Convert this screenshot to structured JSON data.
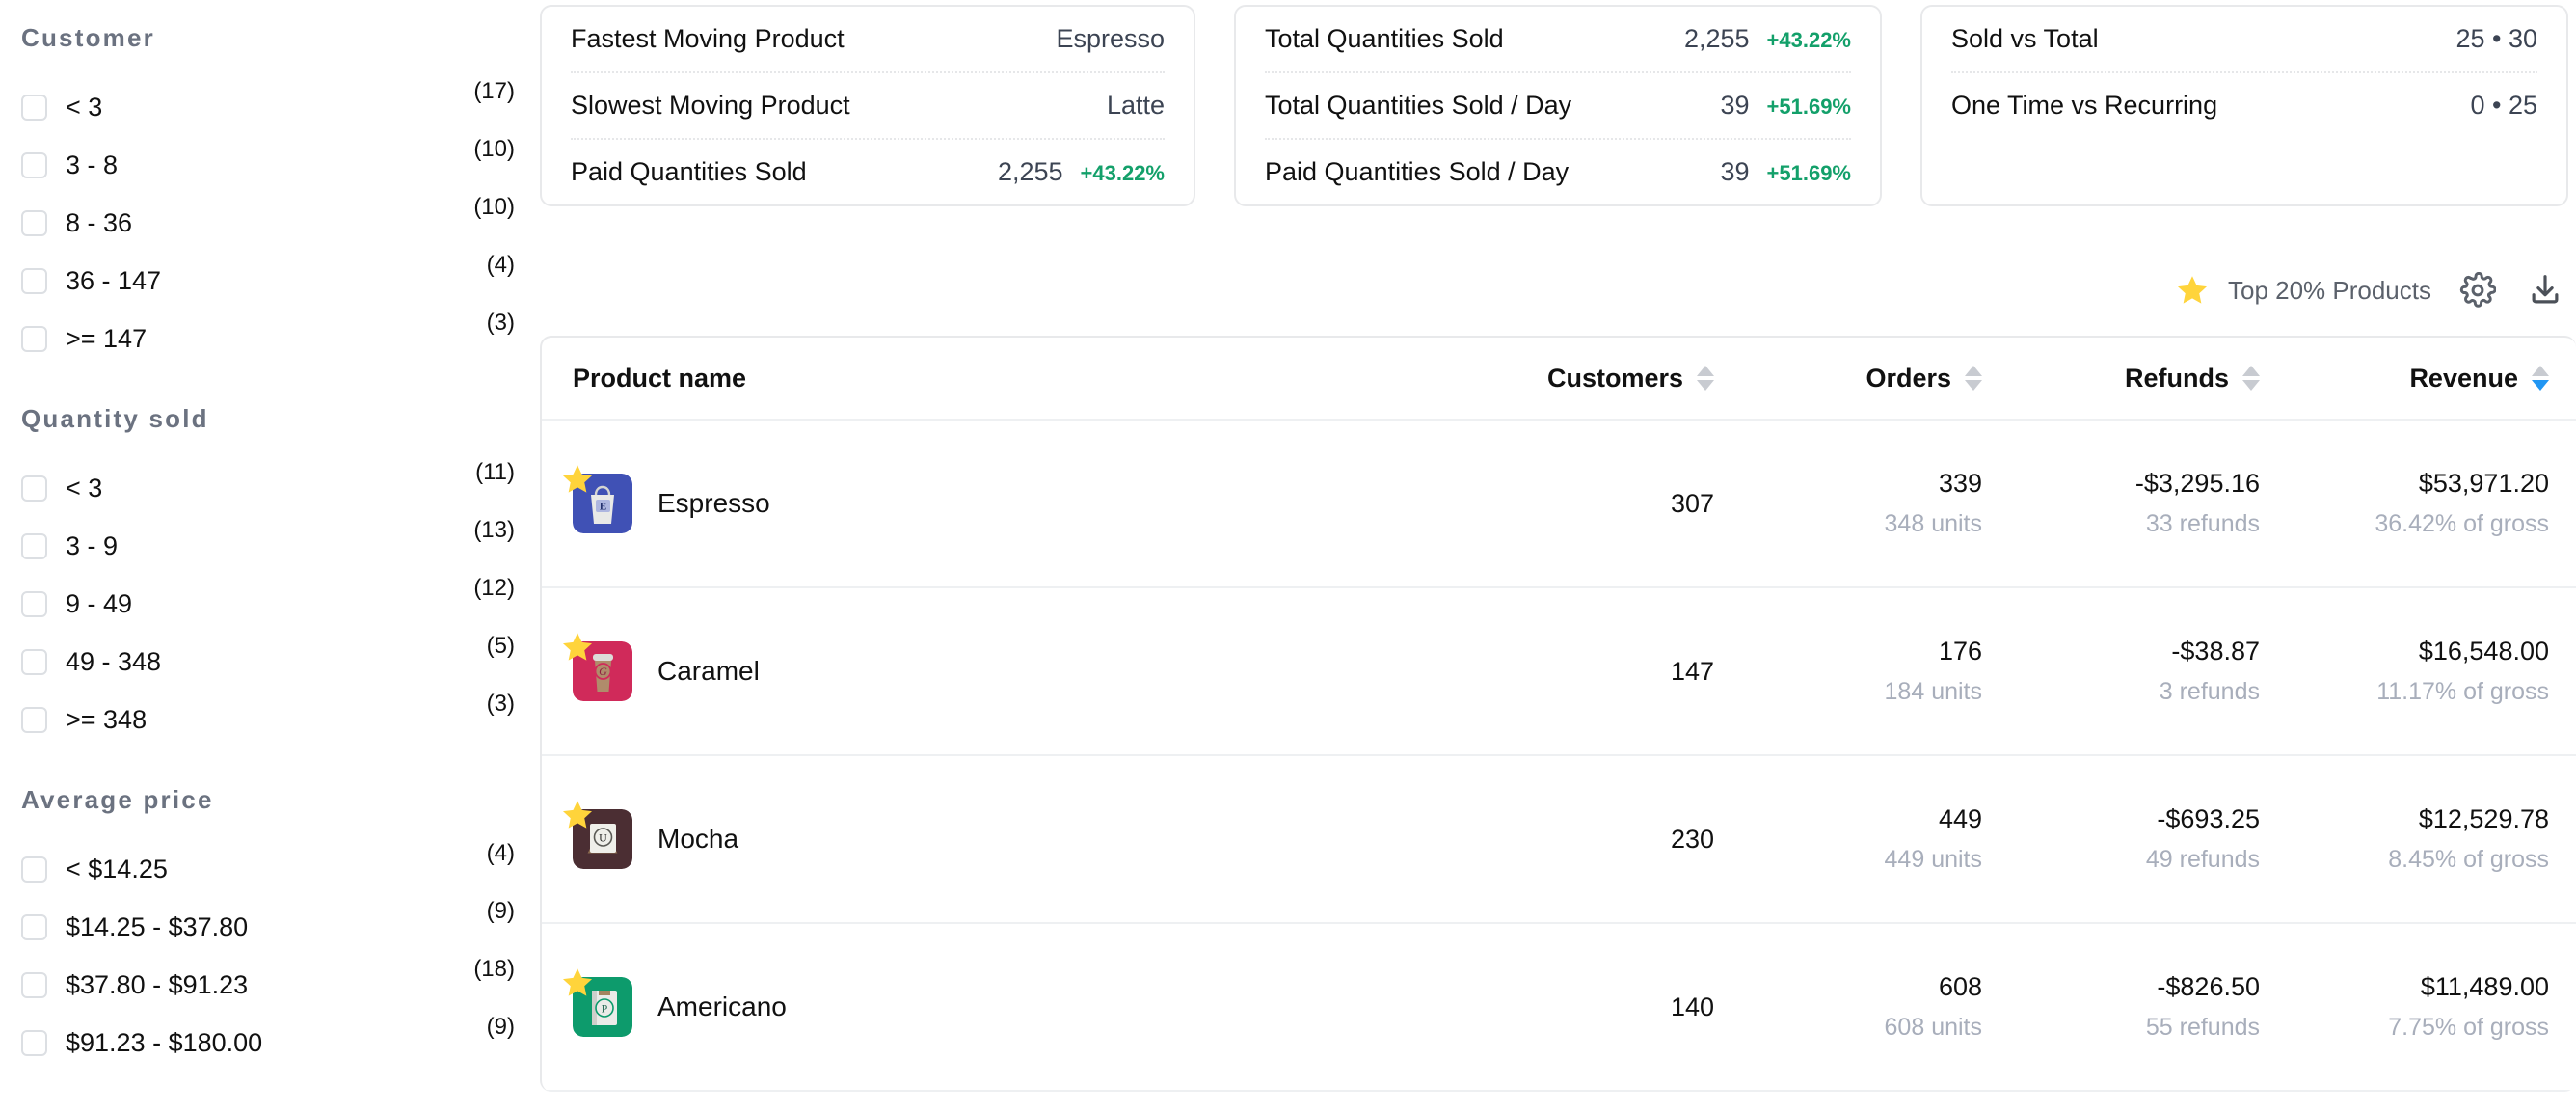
{
  "sidebar": {
    "facets": [
      {
        "title": "Customer",
        "options": [
          {
            "label": "< 3",
            "count": "(17)"
          },
          {
            "label": "3 - 8",
            "count": "(10)"
          },
          {
            "label": "8 - 36",
            "count": "(10)"
          },
          {
            "label": "36 - 147",
            "count": "(4)"
          },
          {
            "label": ">= 147",
            "count": "(3)"
          }
        ]
      },
      {
        "title": "Quantity sold",
        "options": [
          {
            "label": "< 3",
            "count": "(11)"
          },
          {
            "label": "3 - 9",
            "count": "(13)"
          },
          {
            "label": "9 - 49",
            "count": "(12)"
          },
          {
            "label": "49 - 348",
            "count": "(5)"
          },
          {
            "label": ">= 348",
            "count": "(3)"
          }
        ]
      },
      {
        "title": "Average price",
        "options": [
          {
            "label": "< $14.25",
            "count": "(4)"
          },
          {
            "label": "$14.25 - $37.80",
            "count": "(9)"
          },
          {
            "label": "$37.80 - $91.23",
            "count": "(18)"
          },
          {
            "label": "$91.23 - $180.00",
            "count": "(9)"
          }
        ]
      }
    ]
  },
  "kpi_cards": [
    {
      "lines": [
        {
          "name": "Fastest Moving Product",
          "value": "Espresso",
          "delta": ""
        },
        {
          "name": "Slowest Moving Product",
          "value": "Latte",
          "delta": ""
        },
        {
          "name": "Paid Quantities Sold",
          "value": "2,255",
          "delta": "+43.22%"
        }
      ]
    },
    {
      "lines": [
        {
          "name": "Total Quantities Sold",
          "value": "2,255",
          "delta": "+43.22%"
        },
        {
          "name": "Total Quantities Sold / Day",
          "value": "39",
          "delta": "+51.69%"
        },
        {
          "name": "Paid Quantities Sold / Day",
          "value": "39",
          "delta": "+51.69%"
        }
      ]
    },
    {
      "lines": [
        {
          "name": "Sold vs Total",
          "value": "25 • 30",
          "delta": ""
        },
        {
          "name": "One Time vs Recurring",
          "value": "0 • 25",
          "delta": ""
        }
      ]
    }
  ],
  "toolbar": {
    "star_icon": "star-icon",
    "top_products_label": "Top 20% Products",
    "settings_icon": "gear-icon",
    "download_icon": "download-icon"
  },
  "table": {
    "columns": [
      {
        "label": "Product name",
        "sortable": false,
        "sort_state": "none"
      },
      {
        "label": "Customers",
        "sortable": true,
        "sort_state": "none"
      },
      {
        "label": "Orders",
        "sortable": true,
        "sort_state": "none"
      },
      {
        "label": "Refunds",
        "sortable": true,
        "sort_state": "none"
      },
      {
        "label": "Revenue",
        "sortable": true,
        "sort_state": "desc"
      }
    ],
    "rows": [
      {
        "product": "Espresso",
        "thumb_color": "#4051b5",
        "thumb_kind": "bag",
        "thumb_letter": "E",
        "starred": true,
        "customers": "307",
        "orders": "339",
        "orders_sub": "348 units",
        "refunds": "-$3,295.16",
        "refunds_sub": "33 refunds",
        "revenue": "$53,971.20",
        "revenue_sub": "36.42% of gross"
      },
      {
        "product": "Caramel",
        "thumb_color": "#d02a5a",
        "thumb_kind": "cup",
        "thumb_letter": "G",
        "starred": true,
        "customers": "147",
        "orders": "176",
        "orders_sub": "184 units",
        "refunds": "-$38.87",
        "refunds_sub": "3 refunds",
        "revenue": "$16,548.00",
        "revenue_sub": "11.17% of gross"
      },
      {
        "product": "Mocha",
        "thumb_color": "#4b2e33",
        "thumb_kind": "canvas",
        "thumb_letter": "U",
        "starred": true,
        "customers": "230",
        "orders": "449",
        "orders_sub": "449 units",
        "refunds": "-$693.25",
        "refunds_sub": "49 refunds",
        "revenue": "$12,529.78",
        "revenue_sub": "8.45% of gross"
      },
      {
        "product": "Americano",
        "thumb_color": "#0d9b6c",
        "thumb_kind": "book",
        "thumb_letter": "P",
        "starred": true,
        "customers": "140",
        "orders": "608",
        "orders_sub": "608 units",
        "refunds": "-$826.50",
        "refunds_sub": "55 refunds",
        "revenue": "$11,489.00",
        "revenue_sub": "7.75% of gross"
      }
    ]
  },
  "colors": {
    "positive": "#13a06a",
    "star": "#ffd43b",
    "sort_active": "#2196f3",
    "muted": "#a8aebb"
  }
}
